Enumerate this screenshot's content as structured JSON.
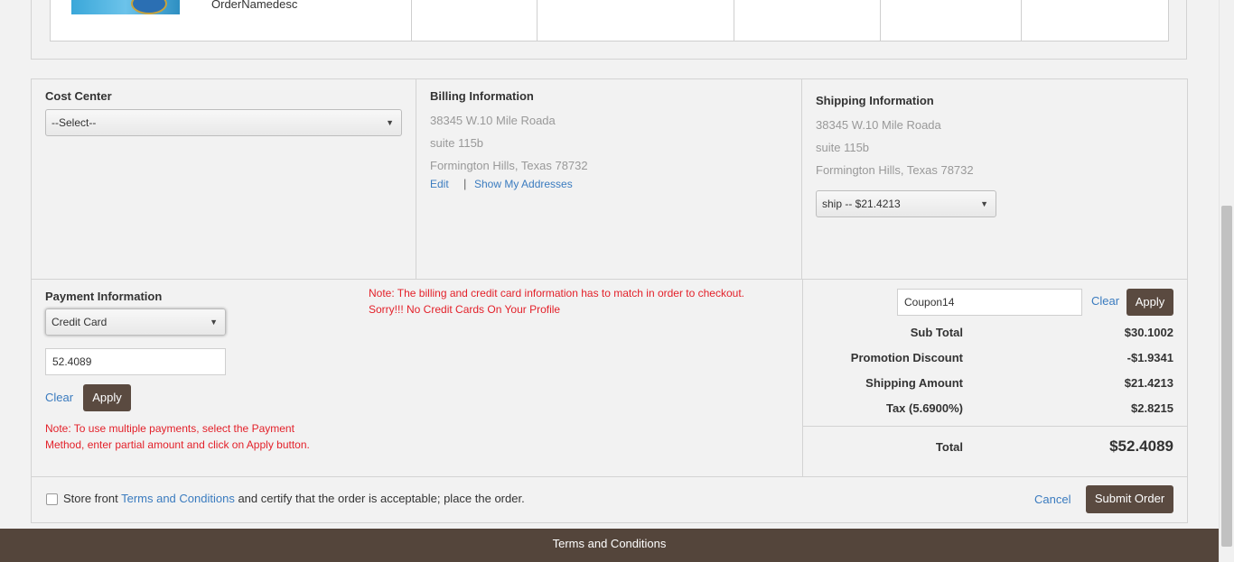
{
  "order": {
    "item_name": "OrderNamedesc"
  },
  "cost_center": {
    "title": "Cost Center",
    "select_value": "--Select--"
  },
  "billing": {
    "title": "Billing Information",
    "line1": "38345 W.10 Mile Roada",
    "line2": "suite 115b",
    "line3": "Formington Hills, Texas 78732",
    "edit_label": "Edit",
    "separator": "|",
    "show_addresses_label": "Show My Addresses"
  },
  "shipping": {
    "title": "Shipping Information",
    "line1": "38345 W.10 Mile Roada",
    "line2": "suite 115b",
    "line3": "Formington Hills, Texas 78732",
    "method_value": "ship -- $21.4213"
  },
  "payment": {
    "title": "Payment Information",
    "method_value": "Credit Card",
    "amount_value": "52.4089",
    "clear_label": "Clear",
    "apply_label": "Apply",
    "note_match_line1": "Note: The billing and credit card information has to match in order to checkout.",
    "note_match_line2": "Sorry!!! No Credit Cards On Your Profile",
    "note_multi_line1": "Note: To use multiple payments, select the Payment",
    "note_multi_line2": "Method, enter partial amount and click on Apply button."
  },
  "summary": {
    "coupon_value": "Coupon14",
    "clear_label": "Clear",
    "apply_label": "Apply",
    "rows": [
      {
        "label": "Sub Total",
        "value": "$30.1002"
      },
      {
        "label": "Promotion Discount",
        "value": "-$1.9341"
      },
      {
        "label": "Shipping Amount",
        "value": "$21.4213"
      },
      {
        "label": "Tax (5.6900%)",
        "value": "$2.8215"
      }
    ],
    "total_label": "Total",
    "total_value": "$52.4089"
  },
  "terms": {
    "prefix": "Store front",
    "link_label": "Terms and Conditions",
    "suffix": "and certify that the order is acceptable; place the order.",
    "cancel_label": "Cancel",
    "submit_label": "Submit Order"
  },
  "footer": {
    "label": "Terms and Conditions"
  },
  "colors": {
    "brand_dark": "#5a4a40",
    "footer_bg": "#54453b",
    "link": "#3a7bbf",
    "warning": "#e3212a"
  },
  "icons": {
    "dropdown": "chevron-down-icon",
    "checkbox": "checkbox-icon"
  }
}
